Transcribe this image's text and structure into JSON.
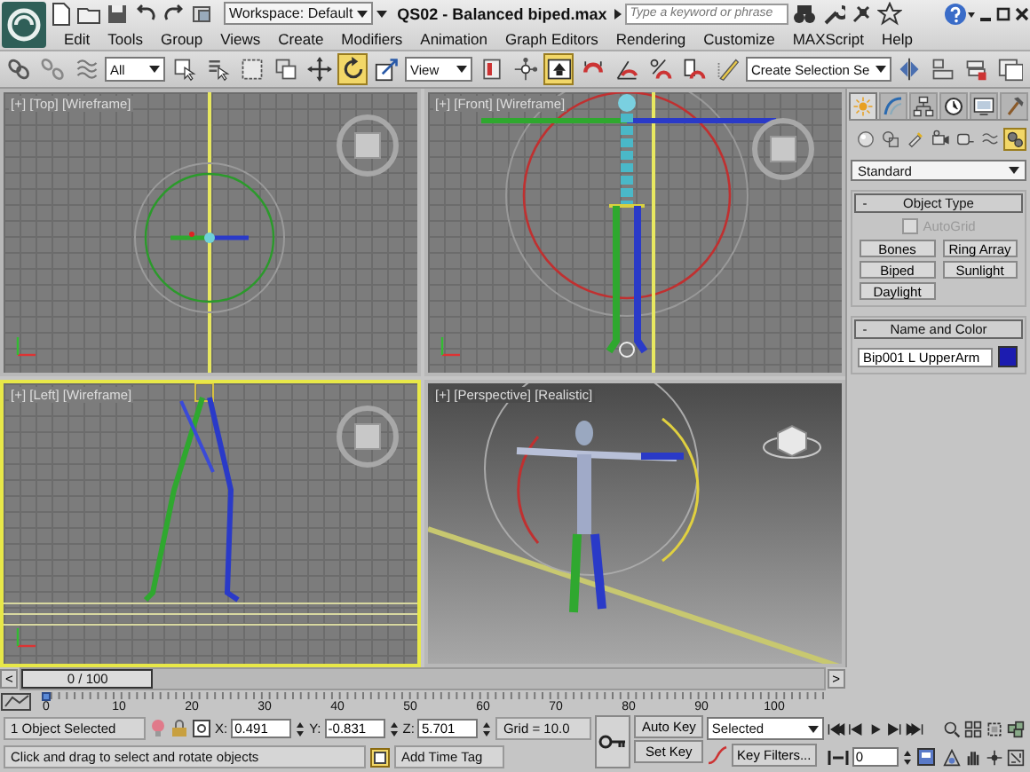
{
  "title_bar": {
    "workspace": "Workspace: Default",
    "title": "QS02 - Balanced biped.max",
    "search": {
      "placeholder": "Type a keyword or phrase"
    }
  },
  "menu": [
    "Edit",
    "Tools",
    "Group",
    "Views",
    "Create",
    "Modifiers",
    "Animation",
    "Graph Editors",
    "Rendering",
    "Customize",
    "MAXScript",
    "Help"
  ],
  "toolbar": {
    "items": [
      {
        "kind": "icon",
        "selected": false
      },
      {
        "kind": "icon",
        "selected": false
      },
      {
        "kind": "icon",
        "selected": false
      },
      {
        "kind": "dropdown",
        "value": "All"
      },
      {
        "kind": "icon",
        "selected": false
      },
      {
        "kind": "icon",
        "selected": false
      },
      {
        "kind": "icon",
        "selected": false
      },
      {
        "kind": "icon",
        "selected": false
      },
      {
        "kind": "icon",
        "selected": false
      },
      {
        "kind": "icon",
        "selected": true
      },
      {
        "kind": "icon",
        "selected": false
      },
      {
        "kind": "dropdown",
        "value": "View"
      },
      {
        "kind": "icon",
        "selected": false
      },
      {
        "kind": "icon",
        "selected": false
      },
      {
        "kind": "icon",
        "selected": true
      },
      {
        "kind": "icon",
        "selected": false
      },
      {
        "kind": "icon",
        "selected": false
      },
      {
        "kind": "icon",
        "selected": false
      },
      {
        "kind": "icon",
        "selected": false
      },
      {
        "kind": "icon",
        "selected": false
      },
      {
        "kind": "dropdown",
        "value": "Create Selection Se"
      },
      {
        "kind": "icon",
        "selected": false
      },
      {
        "kind": "icon",
        "selected": false
      },
      {
        "kind": "icon",
        "selected": false
      },
      {
        "kind": "icon",
        "selected": false
      }
    ]
  },
  "viewports": [
    {
      "kind": "top",
      "label": "[+] [Top] [Wireframe]",
      "active": false
    },
    {
      "kind": "front",
      "label": "[+] [Front] [Wireframe]",
      "active": false
    },
    {
      "kind": "left",
      "label": "[+] [Left] [Wireframe]",
      "active": true
    },
    {
      "kind": "perspective",
      "label": "[+] [Perspective] [Realistic]",
      "active": false
    }
  ],
  "command_panel": {
    "tabs": [
      {
        "selected": true
      },
      {
        "selected": false
      },
      {
        "selected": false
      },
      {
        "selected": false
      },
      {
        "selected": false
      },
      {
        "selected": false
      }
    ],
    "categories": [
      {
        "selected": false
      },
      {
        "selected": false
      },
      {
        "selected": false
      },
      {
        "selected": false
      },
      {
        "selected": false
      },
      {
        "selected": false
      },
      {
        "selected": true
      }
    ],
    "dropdown": "Standard",
    "rollouts": [
      {
        "kind": "object_type",
        "toggle": "-",
        "title": "Object Type",
        "checkbox": {
          "label": "AutoGrid",
          "checked": false,
          "disabled": true
        },
        "buttons": [
          "Bones",
          "Ring Array",
          "Biped",
          "Sunlight",
          "Daylight"
        ]
      },
      {
        "kind": "name_color",
        "toggle": "-",
        "title": "Name and Color",
        "name": "Bip001 L UpperArm",
        "color": "#1c1cb0"
      }
    ]
  },
  "time_slider": {
    "prev": "<",
    "next": ">",
    "label": "0 / 100",
    "level": 0
  },
  "track_bar": {
    "ticks": [
      "0",
      "10",
      "20",
      "30",
      "40",
      "50",
      "60",
      "70",
      "80",
      "90",
      "100"
    ],
    "level": 0
  },
  "status": {
    "selection": "1 Object Selected",
    "coords": [
      {
        "axis": "X:",
        "value": "0.491"
      },
      {
        "axis": "Y:",
        "value": "-0.831"
      },
      {
        "axis": "Z:",
        "value": "5.701"
      }
    ],
    "grid": "Grid = 10.0",
    "prompt": "Click and drag to select and rotate objects",
    "time_tag": "Add Time Tag",
    "auto_key": {
      "label": "Auto Key",
      "on": false
    },
    "set_key": "Set Key",
    "key_mode": "Selected",
    "key_filters": "Key Filters...",
    "frame": "0"
  }
}
